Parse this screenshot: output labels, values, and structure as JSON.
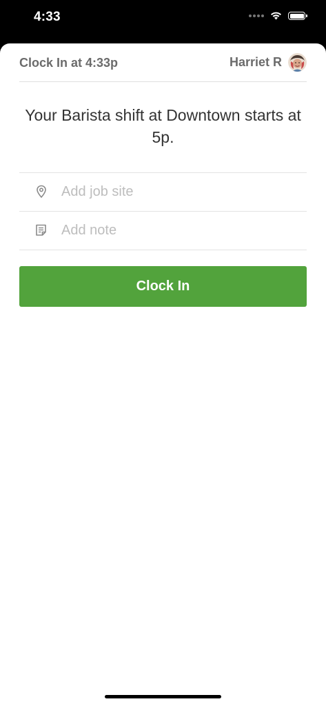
{
  "status_bar": {
    "time": "4:33",
    "icons": [
      "signal-dots-icon",
      "wifi-icon",
      "battery-icon"
    ]
  },
  "header": {
    "title": "Clock In at 4:33p",
    "user_name": "Harriet R"
  },
  "shift_message": "Your Barista shift at Downtown starts at 5p.",
  "fields": {
    "job_site": {
      "placeholder": "Add job site",
      "value": "",
      "icon": "location-pin-icon"
    },
    "note": {
      "placeholder": "Add note",
      "value": "",
      "icon": "note-icon"
    }
  },
  "actions": {
    "clock_in_label": "Clock In"
  },
  "colors": {
    "primary": "#52a33c",
    "text_muted": "#6b6b6b",
    "placeholder": "#bdbdbd"
  }
}
